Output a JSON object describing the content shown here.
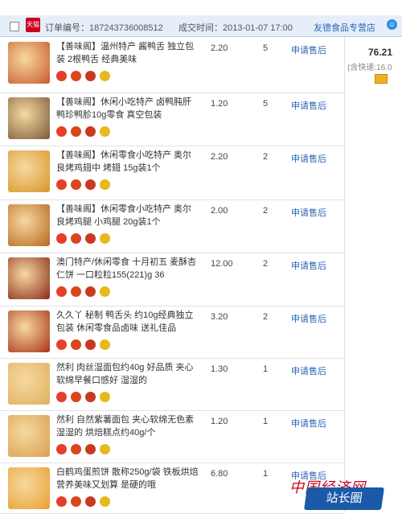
{
  "header": {
    "tmall_label": "天猫",
    "order_label": "订单编号：",
    "order_no": "187243736008512",
    "time_label": "成交时间：",
    "time": "2013-01-07 17:00",
    "shop": "友德食品专营店",
    "contact_icon": "wangwang-icon"
  },
  "summary": {
    "total": "76.21",
    "shipping": "(含快递:16.0"
  },
  "refund_label": "申请售后",
  "items": [
    {
      "title": "【善味阁】温州特产 酱鸭舌 独立包装 2根鸭舌 经典美味",
      "price": "2.20",
      "qty": "5",
      "color": "#c85a2a"
    },
    {
      "title": "【善味阁】休闲小吃特产 卤鸭肫肝鸭珍鸭胗10g零食 真空包装",
      "price": "1.20",
      "qty": "5",
      "color": "#7a5a3a"
    },
    {
      "title": "【善味阁】休闲零食小吃特产 奥尔良烤鸡翅中 烤翅 15g装1个",
      "price": "2.20",
      "qty": "2",
      "color": "#d9962a"
    },
    {
      "title": "【善味阁】休闲零食小吃特产 奥尔良烤鸡腿 小鸡腿 20g装1个",
      "price": "2.00",
      "qty": "2",
      "color": "#b8671e"
    },
    {
      "title": "澳门特产/休闲零食 十月初五 麦酥杏仁饼 一口粒粒155(221)g 36",
      "price": "12.00",
      "qty": "2",
      "color": "#8a2a1a"
    },
    {
      "title": "久久丫 秘制 鸭舌头 约10g经典独立包装 休闲零食品卤味 送礼佳品",
      "price": "3.20",
      "qty": "2",
      "color": "#a8341a"
    },
    {
      "title": "然利 肉丝湿面包约40g 好品质 夹心软绵早餐口感好 湿湿的",
      "price": "1.30",
      "qty": "1",
      "color": "#e0b060"
    },
    {
      "title": "然利 自然紫薯面包 夹心软绵无色素 湿湿的 烘焙糕点约40g/个",
      "price": "1.20",
      "qty": "1",
      "color": "#d8a050"
    },
    {
      "title": "白鹤鸡蛋煎饼 散称250g/袋 铁板烘焙 营养美味又划算 是硬的哦",
      "price": "6.80",
      "qty": "1",
      "color": "#e8a030"
    }
  ],
  "watermark": {
    "top": "中国经济网",
    "bottom": "站长圈"
  }
}
